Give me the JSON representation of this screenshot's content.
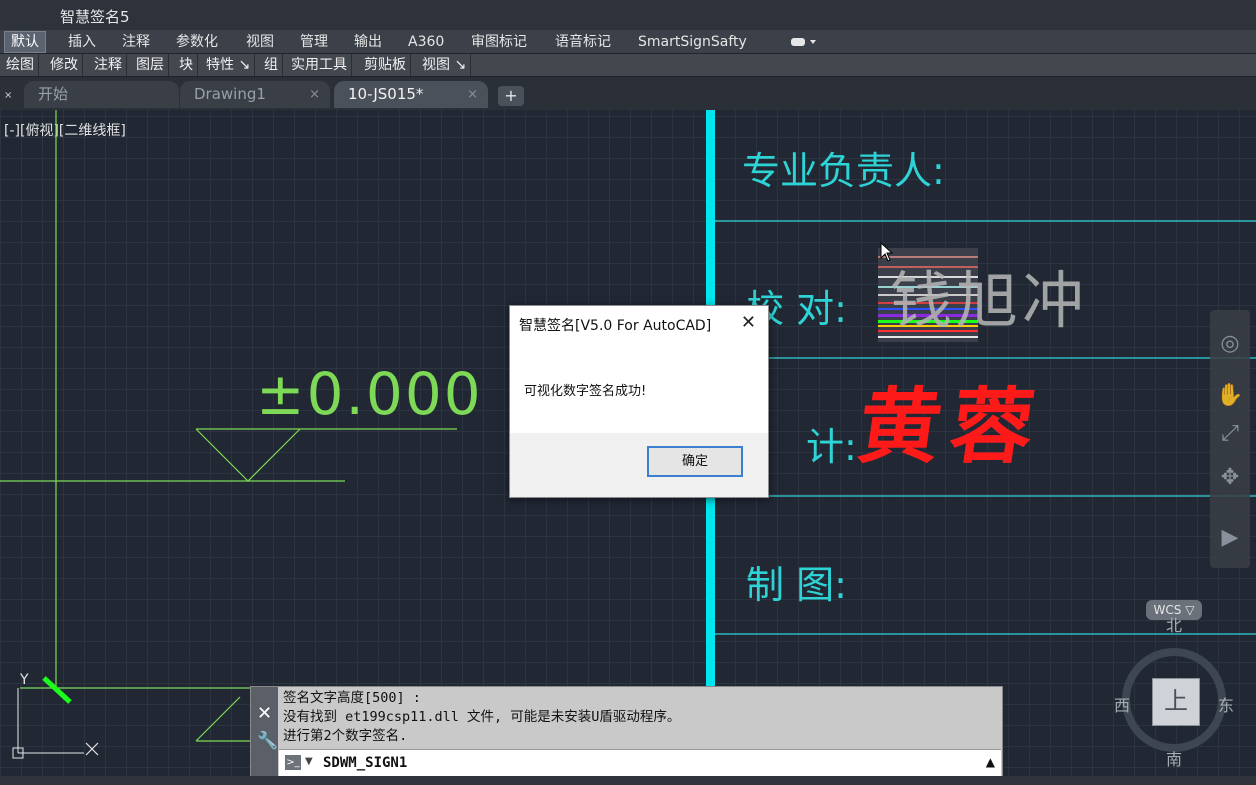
{
  "window": {
    "title": "智慧签名5"
  },
  "ribbon": {
    "tabs": [
      "默认",
      "插入",
      "注释",
      "参数化",
      "视图",
      "管理",
      "输出",
      "A360",
      "审图标记",
      "语音标记",
      "SmartSignSafty"
    ],
    "panels": [
      "绘图",
      "修改",
      "注释",
      "图层",
      "块",
      "特性 ↘",
      "组",
      "实用工具",
      "剪贴板",
      "视图 ↘"
    ]
  },
  "doc_tabs": [
    {
      "label": "开始"
    },
    {
      "label": "Drawing1"
    },
    {
      "label": "10-JS015*"
    }
  ],
  "doc_tab_close": "×",
  "doc_tab_add": "+",
  "viewport": {
    "label": "[-][俯视][二维线框]"
  },
  "drawing": {
    "elevation": "±0.000",
    "title_block": {
      "row1": "专业负责人:",
      "row2": "校   对:",
      "row3": "计:",
      "row4": "制   图:"
    },
    "signature_gray": "钱旭冲",
    "signature_red": "黄蓉"
  },
  "ucs": {
    "y": "Y"
  },
  "navbar": {
    "wcs": "WCS ▽"
  },
  "viewcube": {
    "north": "北",
    "south": "南",
    "east": "东",
    "west": "西",
    "face": "上"
  },
  "dialog": {
    "title": "智慧签名[V5.0 For AutoCAD]",
    "close": "✕",
    "message": "可视化数字签名成功!",
    "ok_label": "确定"
  },
  "command": {
    "history": [
      "签名文字高度[500] :",
      "没有找到 et199csp11.dll 文件, 可能是未安装U盾驱动程序。",
      "进行第2个数字签名."
    ],
    "input": "SDWM_SIGN1"
  },
  "colors": {
    "cyan": "#2ed3d6",
    "green": "#7ed957",
    "signature_red": "#ff1a1a"
  }
}
